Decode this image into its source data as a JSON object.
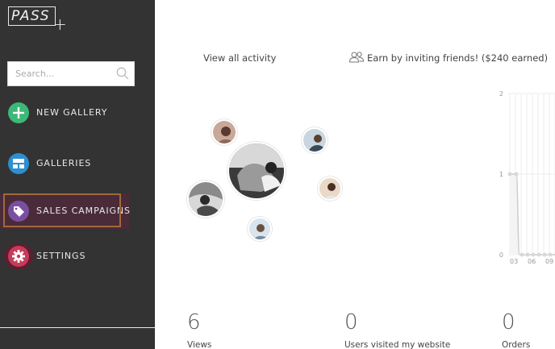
{
  "brand": {
    "logo_text": "PASS",
    "logo_plus": "+"
  },
  "search": {
    "placeholder": "Search..."
  },
  "nav": {
    "new_gallery": "NEW GALLERY",
    "galleries": "GALLERIES",
    "sales_campaigns": "SALES CAMPAIGNS",
    "settings": "SETTINGS"
  },
  "colors": {
    "sidebar_bg": "#333333",
    "new_gallery_icon": "#3cb878",
    "galleries_icon": "#2b8fd0",
    "sales_icon": "#7b4fa0",
    "settings_icon": "#c83a5a"
  },
  "main": {
    "view_activity": "View all activity",
    "invite_text": "Earn by inviting friends! ($240 earned)"
  },
  "chart_data": {
    "type": "line",
    "x": [
      "03",
      "06",
      "09"
    ],
    "y_ticks": [
      0,
      1,
      2
    ],
    "ylim": [
      0,
      2
    ],
    "tick_labels": {
      "y": [
        "2",
        "1",
        "0"
      ],
      "x": [
        "03",
        "06",
        "09"
      ]
    }
  },
  "stats": [
    {
      "value": "6",
      "label": "Views"
    },
    {
      "value": "0",
      "label": "Users visited my website"
    },
    {
      "value": "0",
      "label": "Orders"
    }
  ]
}
